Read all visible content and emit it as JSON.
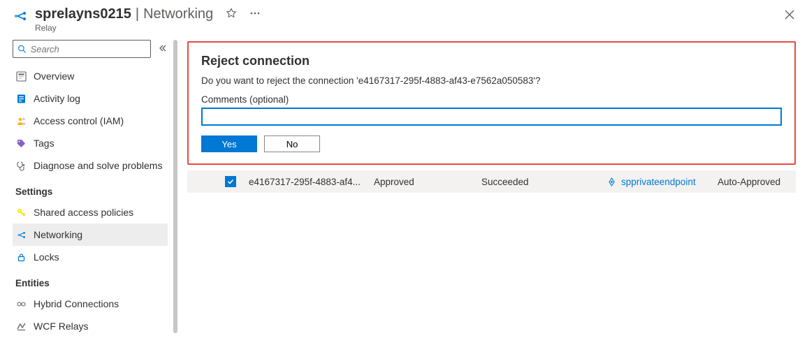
{
  "header": {
    "resource_name": "sprelayns0215",
    "page": "Networking",
    "subtitle": "Relay"
  },
  "search": {
    "placeholder": "Search"
  },
  "nav": {
    "general": [
      {
        "label": "Overview",
        "icon": "overview"
      },
      {
        "label": "Activity log",
        "icon": "activity"
      },
      {
        "label": "Access control (IAM)",
        "icon": "access"
      },
      {
        "label": "Tags",
        "icon": "tag"
      },
      {
        "label": "Diagnose and solve problems",
        "icon": "diagnose"
      }
    ],
    "settings_title": "Settings",
    "settings": [
      {
        "label": "Shared access policies",
        "icon": "key"
      },
      {
        "label": "Networking",
        "icon": "network",
        "active": true
      },
      {
        "label": "Locks",
        "icon": "lock"
      }
    ],
    "entities_title": "Entities",
    "entities": [
      {
        "label": "Hybrid Connections",
        "icon": "hybrid"
      },
      {
        "label": "WCF Relays",
        "icon": "wcf"
      }
    ]
  },
  "dialog": {
    "title": "Reject connection",
    "message": "Do you want to reject the connection 'e4167317-295f-4883-af43-e7562a050583'?",
    "comments_label": "Comments (optional)",
    "comments_value": "",
    "yes": "Yes",
    "no": "No"
  },
  "row": {
    "connection": "e4167317-295f-4883-af4...",
    "state": "Approved",
    "provisioning": "Succeeded",
    "private_endpoint": "spprivateendpoint",
    "description": "Auto-Approved",
    "checked": true
  }
}
